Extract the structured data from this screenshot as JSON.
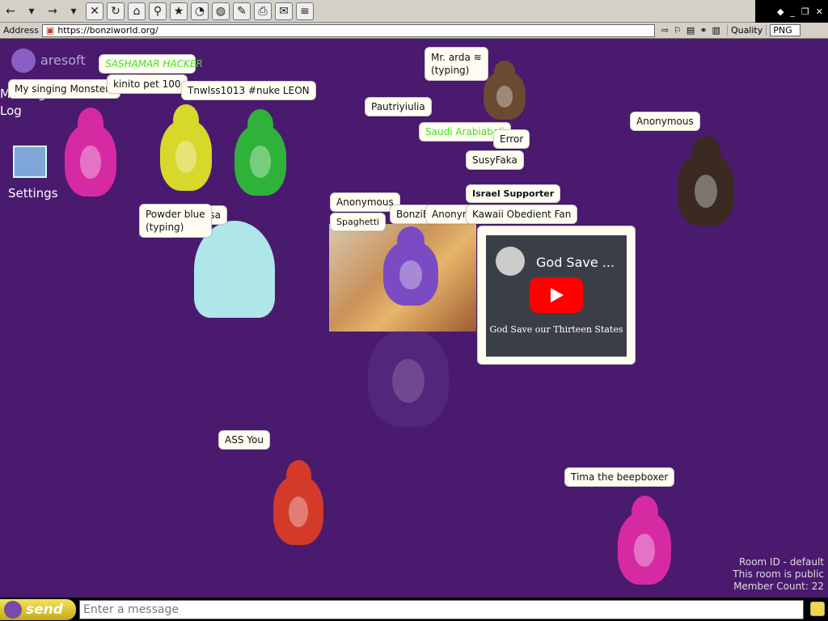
{
  "browser": {
    "address_label": "Address",
    "url": "https://bonziworld.org/",
    "quality_label": "Quality",
    "format": "PNG"
  },
  "desktop": {
    "message_log": "Message Log",
    "settings": "Settings",
    "logo_text": "aresoft"
  },
  "bubbles": {
    "sashamar": "SASHAMAR HACKER",
    "singing": "My singing Monsters",
    "kinito": "kinito pet 100",
    "tnwlss": "Tnwlss1013 #nuke LEON",
    "arda": "Mr. arda ≋\n(typing)",
    "paut": "Pautriyiulia",
    "saudi": "Saudi Arabiabali",
    "error": "Error",
    "susy": "SusyFaka",
    "israel": "Israel Supporter",
    "kawaii": "Kawaii Obedient Fan",
    "anon_right": "Anonymous",
    "powder": "Powder blue\n(typing)",
    "powder_tail": "isa",
    "anon_mid": "Anonymous",
    "spaghetti": "Spaghetti",
    "bonzib": "BonziB",
    "anonym": "Anonym",
    "ass": "ASS You",
    "tima": "Tima the beepboxer"
  },
  "video": {
    "title": "God Save ...",
    "subtitle": "God Save our Thirteen States"
  },
  "room": {
    "id_line": "Room ID - default",
    "public_line": "This room is public",
    "members_line": "Member Count: 22"
  },
  "chat": {
    "send_label": "send",
    "placeholder": "Enter a message"
  },
  "colors": {
    "background": "#4a1a6e",
    "accent_green": "#44dd22"
  }
}
